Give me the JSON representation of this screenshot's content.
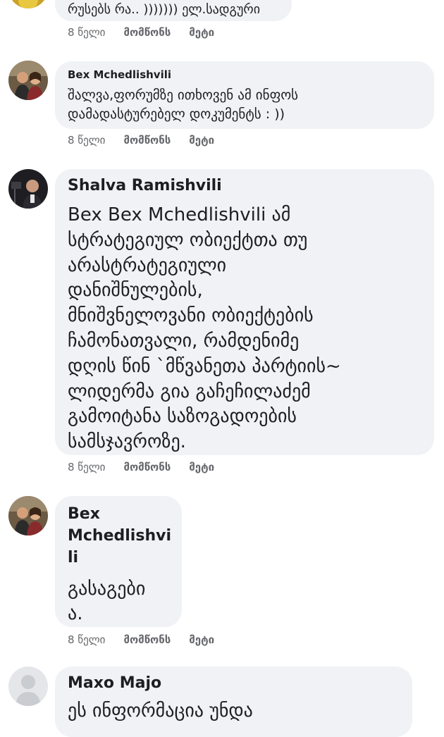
{
  "comments": [
    {
      "author": "",
      "text": "რუსებს რა.. ))))))) ელ.სადგური",
      "time": "8 წელი",
      "like": "მომწონს",
      "more": "მეტი"
    },
    {
      "author": "Bex Mchedlishvili",
      "text": "შალვა,ფორუმზე ითხოვენ ამ ინფოს\nდამადასტურებელ დოკუმენტს : ))",
      "time": "8 წელი",
      "like": "მომწონს",
      "more": "მეტი"
    },
    {
      "author": "Shalva Ramishvili",
      "text": "Bex Bex Mchedlishvili ამ\nსტრატეგიულ ობიექტთა თუ\nარასტრატეგიული\nდანიშნულების,\nმნიშვნელოვანი ობიექტების\nჩამონათვალი, რამდენიმე\nდღის წინ `მწვანეთა პარტიის~\nლიდერმა გია გაჩეჩილაძემ\nგამოიტანა საზოგადოების\nსამსჯავროზე.",
      "time": "8 წელი",
      "like": "მომწონს",
      "more": "მეტი"
    },
    {
      "author": "Bex\nMchedlishvi\nli",
      "text": "გასაგები\nა.",
      "time": "8 წელი",
      "like": "მომწონს",
      "more": "მეტი"
    },
    {
      "author": "Maxo Majo",
      "text": "ეს ინფორმაცია უნდა",
      "time": "",
      "like": "",
      "more": ""
    }
  ],
  "colors": {
    "bubble": "#f0f2f5",
    "text": "#1c1e21",
    "secondary": "#65676b",
    "placeholder_avatar": "#c9ccd1"
  }
}
